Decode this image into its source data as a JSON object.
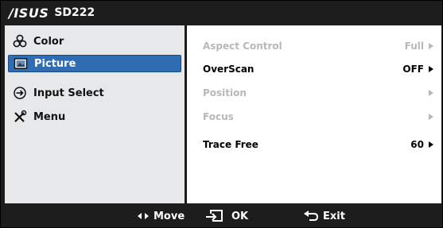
{
  "title": {
    "brand": "/ISUS",
    "model": "SD222"
  },
  "menu": {
    "items": [
      {
        "label": "Color",
        "icon": "color-palette-icon",
        "selected": false
      },
      {
        "label": "Picture",
        "icon": "picture-icon",
        "selected": true
      },
      {
        "label": "Input Select",
        "icon": "input-select-icon",
        "selected": false
      },
      {
        "label": "Menu",
        "icon": "tools-icon",
        "selected": false
      }
    ]
  },
  "options": [
    {
      "label": "Aspect Control",
      "value": "Full",
      "enabled": false
    },
    {
      "label": "OverScan",
      "value": "OFF",
      "enabled": true
    },
    {
      "label": "Position",
      "value": "",
      "enabled": false
    },
    {
      "label": "Focus",
      "value": "",
      "enabled": false
    },
    {
      "label": "Trace Free",
      "value": "60",
      "enabled": true
    }
  ],
  "footer": {
    "move_label": "Move",
    "ok_label": "OK",
    "exit_label": "Exit"
  },
  "colors": {
    "frame": "#1d1d1d",
    "left_panel": "#e6e8ea",
    "selected": "#2f6cb1",
    "disabled_text": "#b8b8b8"
  }
}
